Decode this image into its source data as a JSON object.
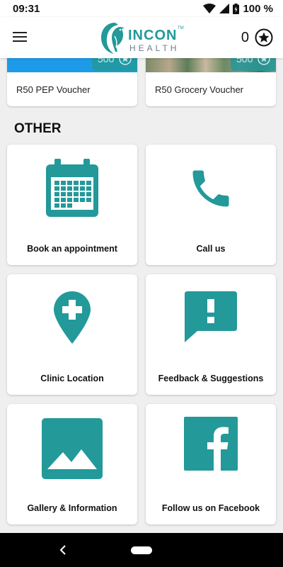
{
  "status": {
    "time": "09:31",
    "battery": "100 %"
  },
  "header": {
    "brand_main": "INCON",
    "brand_tm": "TM",
    "brand_sub": "HEALTH",
    "points": "0"
  },
  "vouchers": [
    {
      "title": "R50 PEP Voucher",
      "points": "500"
    },
    {
      "title": "R50 Grocery Voucher",
      "points": "500"
    }
  ],
  "other": {
    "title": "OTHER",
    "tiles": [
      {
        "label": "Book an appointment",
        "icon": "calendar-icon"
      },
      {
        "label": "Call us",
        "icon": "phone-icon"
      },
      {
        "label": "Clinic Location",
        "icon": "location-pin-plus-icon"
      },
      {
        "label": "Feedback & Suggestions",
        "icon": "feedback-icon"
      },
      {
        "label": "Gallery & Information",
        "icon": "gallery-icon"
      },
      {
        "label": "Follow us on Facebook",
        "icon": "facebook-icon"
      }
    ]
  },
  "colors": {
    "accent": "#23999a",
    "background": "#efefef",
    "card": "#ffffff",
    "voucher_blue": "#1e9be8"
  }
}
